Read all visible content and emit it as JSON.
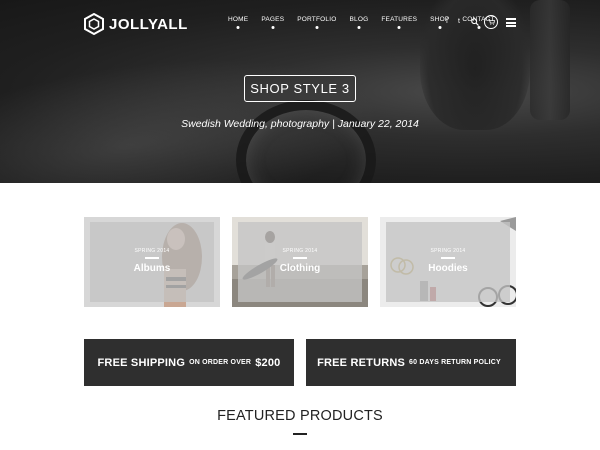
{
  "brand": {
    "name": "JOLLYALL"
  },
  "nav": {
    "items": [
      "HOME",
      "PAGES",
      "PORTFOLIO",
      "BLOG",
      "FEATURES",
      "SHOP",
      "CONTACT"
    ],
    "social": [
      "f",
      "t"
    ],
    "icons": [
      "facebook-icon",
      "twitter-icon",
      "search-icon",
      "cart-icon",
      "menu-icon"
    ]
  },
  "hero": {
    "title": "SHOP STYLE 3",
    "subtitle": "Swedish Wedding, photography | January 22, 2014"
  },
  "categories": [
    {
      "kicker": "SPRING 2014",
      "label": "Albums"
    },
    {
      "kicker": "SPRING 2014",
      "label": "Clothing"
    },
    {
      "kicker": "SPRING 2014",
      "label": "Hoodies"
    }
  ],
  "banners": [
    {
      "main": "FREE SHIPPING",
      "small": "ON ORDER OVER",
      "tail": "$200"
    },
    {
      "main": "FREE RETURNS",
      "small": "60 DAYS RETURN POLICY",
      "tail": ""
    }
  ],
  "featured": {
    "title": "FEATURED PRODUCTS"
  },
  "colors": {
    "hero_dark": "#1f1f1f",
    "banner_bg": "#2f2f2f",
    "card_overlay": "#c4c4c4",
    "text": "#222222"
  }
}
